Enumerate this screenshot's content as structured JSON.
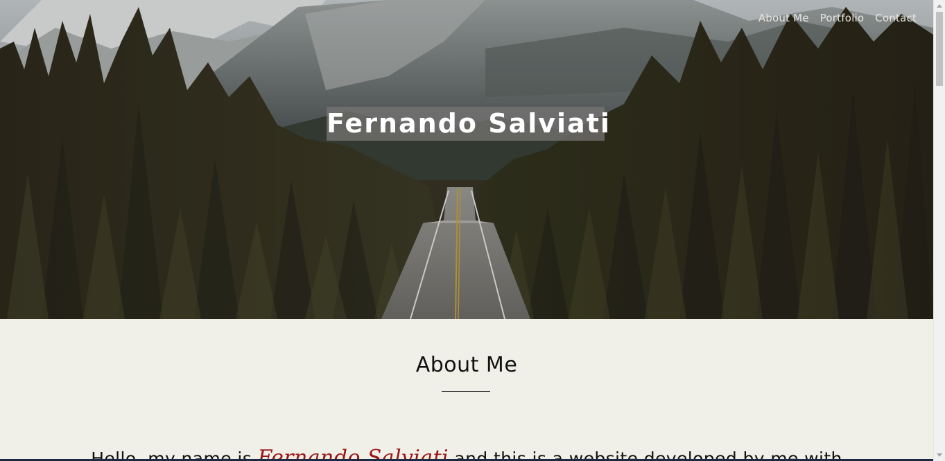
{
  "nav": {
    "items": [
      {
        "label": "About Me"
      },
      {
        "label": "Portfolio"
      },
      {
        "label": "Contact"
      }
    ]
  },
  "hero": {
    "title": "Fernando Salviati",
    "background": "mountain-road-forest-photo"
  },
  "about": {
    "heading": "About Me",
    "intro_prefix": "Hello, my name is ",
    "intro_name": "Fernando Salviati",
    "intro_suffix": " and this is a website developed by me with"
  },
  "colors": {
    "background": "#f0f0e9",
    "name_accent": "#9b1414",
    "nav_text": "#e8e6e1",
    "title_box": "#787676"
  },
  "icons": {
    "scroll_up": "chevron-up-icon",
    "scroll_down": "chevron-down-icon"
  }
}
